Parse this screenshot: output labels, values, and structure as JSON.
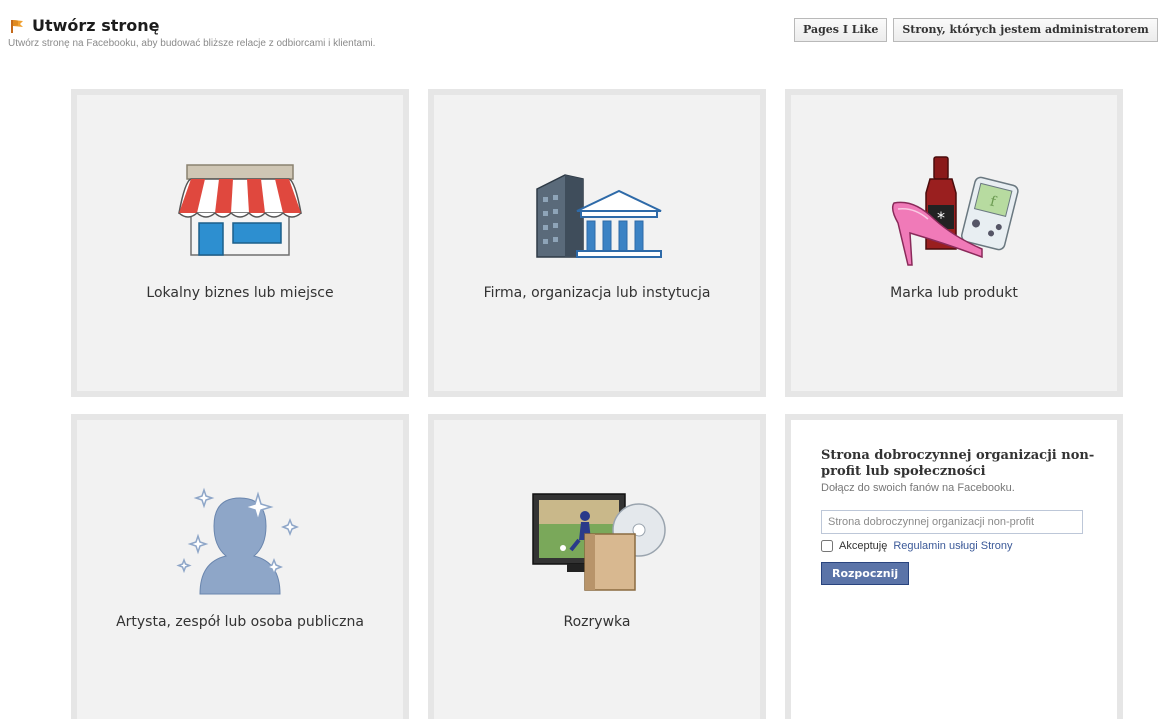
{
  "header": {
    "title": "Utwórz stronę",
    "subtitle": "Utwórz stronę na Facebooku, aby budować bliższe relacje z odbiorcami i klientami.",
    "buttons": {
      "pages_i_like": "Pages I Like",
      "admin_pages": "Strony, których jestem administratorem"
    }
  },
  "tiles": [
    {
      "label": "Lokalny biznes lub miejsce",
      "icon": "storefront-icon"
    },
    {
      "label": "Firma, organizacja lub instytucja",
      "icon": "buildings-icon"
    },
    {
      "label": "Marka lub produkt",
      "icon": "products-icon"
    },
    {
      "label": "Artysta, zespół lub osoba publiczna",
      "icon": "artist-icon"
    },
    {
      "label": "Rozrywka",
      "icon": "entertainment-icon"
    }
  ],
  "nonprofit": {
    "title": "Strona dobroczynnej organizacji non-profit lub społeczności",
    "description": "Dołącz do swoich fanów na Facebooku.",
    "input_placeholder": "Strona dobroczynnej organizacji non-profit",
    "accept_text": "Akceptuję",
    "terms_link": "Regulamin usługi Strony",
    "start_button": "Rozpocznij"
  },
  "colors": {
    "accent": "#3b5998",
    "tile_background": "#f2f2f2",
    "tile_border": "#e6e6e6",
    "start_button": "#5b74a8"
  }
}
